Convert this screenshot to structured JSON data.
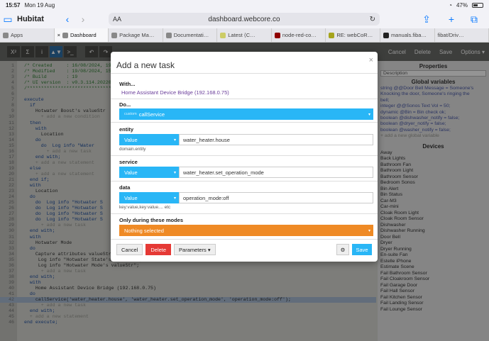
{
  "status": {
    "time": "15:57",
    "date": "Mon 19 Aug",
    "battery": "47%"
  },
  "browser": {
    "app_title": "Hubitat",
    "url": "dashboard.webcore.co",
    "aa": "AA"
  },
  "tabs": [
    {
      "label": "Apps"
    },
    {
      "label": "Dashboard"
    },
    {
      "label": "Package Ma…"
    },
    {
      "label": "Documentati…"
    },
    {
      "label": "Latest ⟨C…"
    },
    {
      "label": "node-red-co…"
    },
    {
      "label": "RE: webCoR…"
    },
    {
      "label": "manuals.fiba…"
    },
    {
      "label": "fibat/Driv…"
    }
  ],
  "toolbar": {
    "buttons": [
      "X²",
      "Σ",
      "i",
      "▲▼",
      ">_",
      "↶",
      "↷"
    ],
    "right": [
      "Cancel",
      "Delete",
      "Save",
      "Options ▾"
    ]
  },
  "code": {
    "lines": [
      {
        "n": "1",
        "t": "/* Created     : 16/08/2024, 19:15:4"
      },
      {
        "n": "2",
        "t": "/* Modified    : 19/08/2024, 15:26:1"
      },
      {
        "n": "3",
        "t": "/* Build       : 19"
      },
      {
        "n": "4",
        "t": "/* UI version  : v0.3.114.20220203"
      },
      {
        "n": "5",
        "t": "/*****************************************"
      },
      {
        "n": "6",
        "t": ""
      },
      {
        "n": "7",
        "t": "execute"
      },
      {
        "n": "8",
        "t": "  if"
      },
      {
        "n": "9",
        "t": "    Hotwater Boost's valueStr"
      },
      {
        "n": "10",
        "t": "      + add a new condition"
      },
      {
        "n": "11",
        "t": "  then"
      },
      {
        "n": "12",
        "t": "    with"
      },
      {
        "n": "13",
        "t": "      Location"
      },
      {
        "n": "14",
        "t": "    do"
      },
      {
        "n": "15",
        "t": "      do  Log info \"Water"
      },
      {
        "n": "16",
        "t": "        + add a new task"
      },
      {
        "n": "17",
        "t": "    end with;"
      },
      {
        "n": "18",
        "t": "    + add a new statement"
      },
      {
        "n": "19",
        "t": "  else"
      },
      {
        "n": "20",
        "t": "    + add a new statement"
      },
      {
        "n": "21",
        "t": "  end if;"
      },
      {
        "n": "22",
        "t": "  with"
      },
      {
        "n": "23",
        "t": "    Location"
      },
      {
        "n": "24",
        "t": "  do"
      },
      {
        "n": "25",
        "t": "    do  Log info \"Hotwater S"
      },
      {
        "n": "26",
        "t": "    do  Log info \"Hotwater S"
      },
      {
        "n": "27",
        "t": "    do  Log info \"Hotwater S"
      },
      {
        "n": "28",
        "t": "    do  Log info \"Hotwater S"
      },
      {
        "n": "29",
        "t": "      + add a new task"
      },
      {
        "n": "30",
        "t": "  end with;"
      },
      {
        "n": "31",
        "t": "  with"
      },
      {
        "n": "32",
        "t": "    Hotwater Mode"
      },
      {
        "n": "33",
        "t": "  do"
      },
      {
        "n": "34",
        "t": "    Capture attributes valueStr to local state (empty);"
      },
      {
        "n": "35",
        "t": "     Log info \"Hotwater State's valueStr\";"
      },
      {
        "n": "36",
        "t": "     Log info \"Hotwater Mode's valueStr\";"
      },
      {
        "n": "37",
        "t": "      + add a new task"
      },
      {
        "n": "38",
        "t": "  end with;"
      },
      {
        "n": "39",
        "t": "  with"
      },
      {
        "n": "40",
        "t": "    Home Assistant Device Bridge (192.168.0.75)"
      },
      {
        "n": "41",
        "t": "  do"
      },
      {
        "n": "42",
        "t": "    callService('water_heater.house', 'water_heater.set_operation_mode', 'operation_mode:off');"
      },
      {
        "n": "43",
        "t": "      + add a new task"
      },
      {
        "n": "44",
        "t": "  end with;"
      },
      {
        "n": "45",
        "t": "  + add a new statement"
      },
      {
        "n": "46",
        "t": "end execute;"
      }
    ]
  },
  "side": {
    "properties_title": "Properties",
    "description_placeholder": "Description",
    "globals_title": "Global variables",
    "globals": [
      "string @@Door Bell Message = Someone's",
      "Knocking the door, Someone's ringing the",
      "bell;",
      "integer @@Sonos Text Vol = 50;",
      "dynamic @Bin = Bin check ok;",
      "boolean @dishwasher_notify = false;",
      "boolean @dryer_notify = false;",
      "boolean @washer_notify = false;",
      "+ add a new global variable"
    ],
    "devices_title": "Devices",
    "devices": [
      "Away",
      "Back Lights",
      "Bathroom Fan",
      "Bathroom Light",
      "Bathroom Sensor",
      "Bedroom Sonos",
      "Bin Alert",
      "Bin Status",
      "Car-M3",
      "Car-mini",
      "Cloak Room Light",
      "Cloak Room Sensor",
      "Dishwasher",
      "Dishwasher Running",
      "Door Bell",
      "Dryer",
      "Dryer Running",
      "En-suite Fan",
      "Estelle iPhone",
      "Estimate Scene",
      "Fail Bathroom Sensor",
      "Fail Cloakroom Sensor",
      "Fail Garage Door",
      "Fail Hall Sensor",
      "Fail Kitchen Sensor",
      "Fail Landing Sensor",
      "Fail Lounge Sensor"
    ]
  },
  "modal": {
    "title": "Add a new task",
    "close": "×",
    "with_label": "With...",
    "with_value": "Home Assistant Device Bridge (192.168.0.75)",
    "do_label": "Do...",
    "do_prefix": "custom",
    "do_value": "callService",
    "entity_label": "entity",
    "entity_type": "Value",
    "entity_value": "water_heater.house",
    "entity_hint": "domain.entity",
    "service_label": "service",
    "service_type": "Value",
    "service_value": "water_heater.set_operation_mode",
    "data_label": "data",
    "data_type": "Value",
    "data_value": "operation_mode:off",
    "data_hint": "key:value,key:value.... etc",
    "modes_label": "Only during these modes",
    "modes_value": "Nothing selected",
    "cancel": "Cancel",
    "delete": "Delete",
    "parameters": "Parameters ▾",
    "save": "Save",
    "gear_icon": "gear-icon"
  },
  "colors": {
    "accent": "#29b6f6",
    "delete": "#e53935",
    "orange": "#ef8a25"
  }
}
